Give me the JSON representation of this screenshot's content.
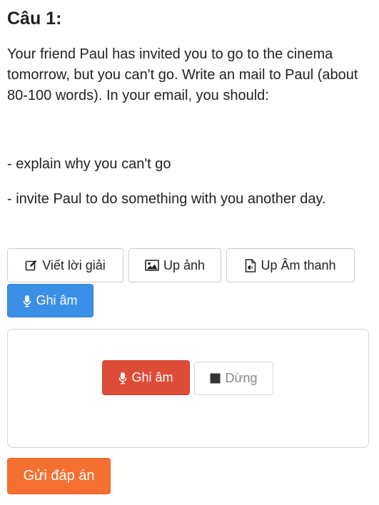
{
  "question": {
    "title": "Câu 1:",
    "prompt": "Your friend Paul has invited you to go to the cinema tomorrow, but you can't go. Write an mail to Paul (about 80-100 words). In your email, you should:",
    "bullet1": "- explain why you can't go",
    "bullet2": "- invite Paul to do something with you another day."
  },
  "answer_tools": {
    "write_label": "Viết lời giải",
    "upload_image_label": "Up ảnh",
    "upload_audio_label": "Up Âm thanh",
    "record_label": "Ghi âm"
  },
  "recorder": {
    "record_label": "Ghi âm",
    "stop_label": "Dừng"
  },
  "submit_label": "Gửi đáp án",
  "colors": {
    "record_blue": "#3a8fe6",
    "record_red": "#dd4b39",
    "submit_orange": "#f46f30"
  },
  "icons": [
    "pencil-square-icon",
    "image-icon",
    "audio-file-icon",
    "microphone-icon",
    "stop-square-icon"
  ]
}
